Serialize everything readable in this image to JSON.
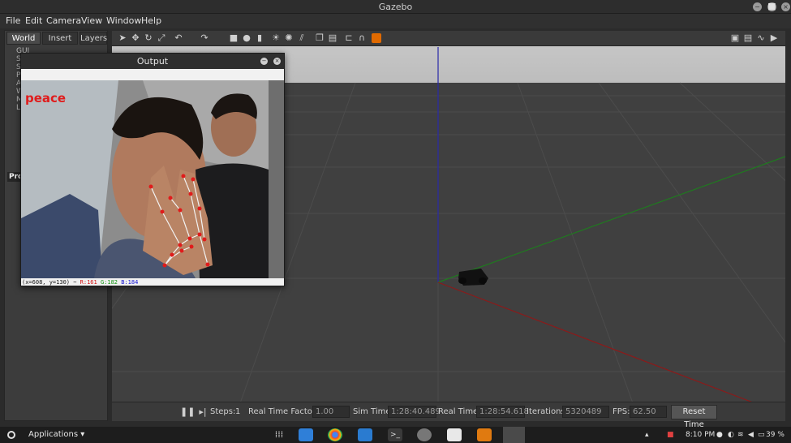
{
  "window": {
    "title": "Gazebo"
  },
  "menu": [
    "File",
    "Edit",
    "Camera",
    "View",
    "Window",
    "Help"
  ],
  "left_panel": {
    "tabs": [
      "World",
      "Insert",
      "Layers"
    ],
    "active_tab": "World",
    "tree_items": [
      "GUI",
      "S",
      "S",
      "P",
      "A",
      "W",
      "M",
      "L"
    ],
    "properties_label": "Pro"
  },
  "output_window": {
    "title": "Output",
    "gesture_label": "peace",
    "status_coords": "(x=608, y=130) ~",
    "status_r": "R:161",
    "status_g": "G:182",
    "status_b": "B:184"
  },
  "bottom": {
    "steps_label": "Steps:",
    "steps_value": "1",
    "rtf_label": "Real Time Factor:",
    "rtf_value": "1.00",
    "sim_label": "Sim Time:",
    "sim_value": "1:28:40.489",
    "real_label": "Real Time:",
    "real_value": "1:28:54.618",
    "iter_label": "Iterations:",
    "iter_value": "5320489",
    "fps_label": "FPS:",
    "fps_value": "62.50",
    "reset_label": "Reset Time"
  },
  "taskbar": {
    "applications": "Applications",
    "time": "8:10 PM",
    "battery": "39 %"
  },
  "colors": {
    "gesture_text": "#e01b1b",
    "landmark": "#e01b1b",
    "x_axis": "#8b1a1a",
    "y_axis": "#1f7a1f",
    "z_axis": "#2929a8"
  },
  "icons": [
    "select-icon",
    "translate-icon",
    "rotate-icon",
    "scale-icon",
    "undo-icon",
    "redo-icon",
    "box-icon",
    "sphere-icon",
    "cylinder-icon",
    "point-light-icon",
    "spot-light-icon",
    "directional-light-icon",
    "copy-icon",
    "paste-icon",
    "align-icon",
    "snap-icon",
    "camera-screenshot-icon",
    "log-icon",
    "plot-icon",
    "record-icon"
  ]
}
